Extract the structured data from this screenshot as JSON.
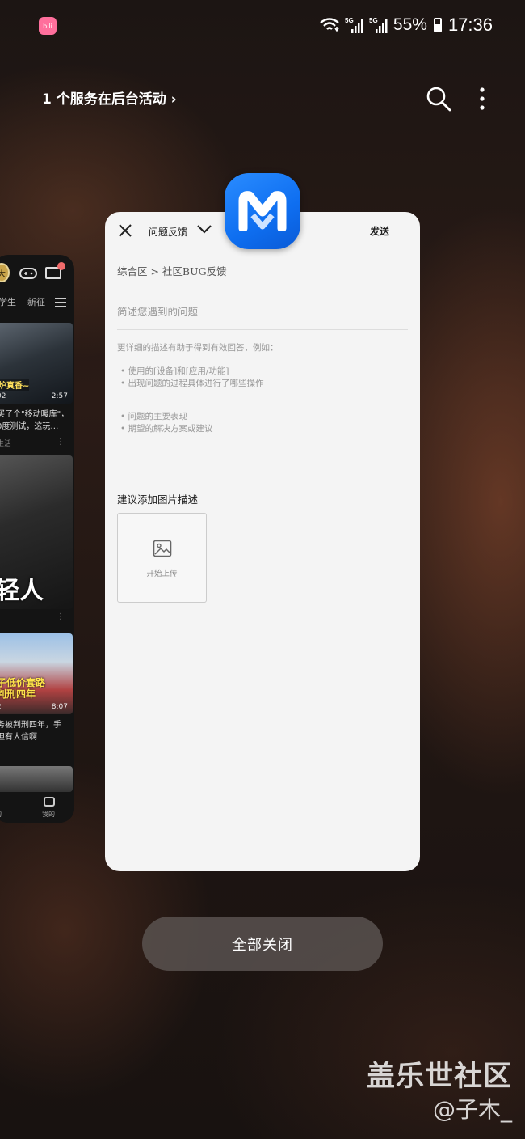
{
  "status_bar": {
    "app_icon_label": "bili",
    "network": [
      "5G",
      "5G"
    ],
    "battery": "55%",
    "time": "17:36"
  },
  "top_bar": {
    "background_activity": "1 个服务在后台活动",
    "search_icon": "search-icon",
    "more_icon": "more-vert-icon"
  },
  "left_card": {
    "avatar_text": "大",
    "tabs": [
      "学生",
      "新征"
    ],
    "videos": [
      {
        "caption": "炉真香~",
        "views": "02",
        "duration": "2:57",
        "title": "买了个\"移动暖库\"，0度测试，这玩…",
        "tag": "生活"
      },
      {
        "caption": "轻人"
      },
      {
        "caption_lines": [
          "子低价套路",
          "判刑四年"
        ],
        "views": "2",
        "duration": "8:07",
        "title": "务被判刑四年，手 但有人信啊"
      }
    ],
    "bottom_nav": [
      "购",
      "我的"
    ]
  },
  "feedback_card": {
    "title": "问题反馈",
    "send": "发送",
    "breadcrumb": "综合区 > 社区BUG反馈",
    "summary_placeholder": "简述您遇到的问题",
    "description_intro": "更详细的描述有助于得到有效回答，例如：",
    "hints_group1": [
      "• 使用的[设备]和[应用/功能]",
      "• 出现问题的过程具体进行了哪些操作"
    ],
    "hints_group2": [
      "• 问题的主要表现",
      "• 期望的解决方案或建议"
    ],
    "image_label": "建议添加图片描述",
    "upload_label": "开始上传"
  },
  "app_icon_letter": "M",
  "colors": {
    "app_icon_blue": "#1676f5",
    "card_bg": "#f4f4f4"
  },
  "close_all": "全部关闭",
  "watermark": {
    "title": "盖乐世社区",
    "user": "@子木_"
  }
}
